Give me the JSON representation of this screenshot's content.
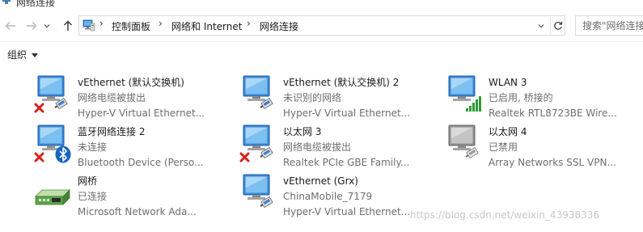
{
  "window": {
    "title": "网络连接"
  },
  "nav": {
    "back_icon": "arrow-left-icon",
    "forward_icon": "arrow-right-icon",
    "recent_icon": "chevron-down-icon",
    "up_icon": "arrow-up-icon"
  },
  "address": {
    "crumbs": [
      "控制面板",
      "网络和 Internet",
      "网络连接"
    ],
    "separator": "›"
  },
  "search": {
    "placeholder": "搜索\"网络连接\""
  },
  "toolbar": {
    "organize_label": "组织"
  },
  "connections": [
    {
      "name": "vEthernet (默认交换机)",
      "status": "网络电缆被拔出",
      "device": "Hyper-V Virtual Ethernet...",
      "icon": "ethernet-adapter-icon",
      "badge": "red-x"
    },
    {
      "name": "vEthernet (默认交换机) 2",
      "status": "未识别的网络",
      "device": "Hyper-V Virtual Ethernet...",
      "icon": "ethernet-adapter-icon",
      "badge": "none"
    },
    {
      "name": "WLAN 3",
      "status": "已启用, 桥接的",
      "device": "Realtek RTL8723BE Wire...",
      "icon": "wireless-adapter-icon",
      "badge": "signal"
    },
    {
      "name": "蓝牙网络连接 2",
      "status": "未连接",
      "device": "Bluetooth Device (Perso...",
      "icon": "bluetooth-adapter-icon",
      "badge": "red-x-bluetooth"
    },
    {
      "name": "以太网 3",
      "status": "网络电缆被拔出",
      "device": "Realtek PCIe GBE Family...",
      "icon": "ethernet-adapter-icon",
      "badge": "red-x"
    },
    {
      "name": "以太网 4",
      "status": "已禁用",
      "device": "Array Networks SSL VPN...",
      "icon": "ethernet-adapter-disabled-icon",
      "badge": "none"
    },
    {
      "name": "网桥",
      "status": "已连接",
      "device": "Microsoft Network Ada...",
      "icon": "network-bridge-icon",
      "badge": "none"
    },
    {
      "name": "vEthernet (Grx)",
      "status": "ChinaMobile_7179",
      "device": "Hyper-V Virtual Ethernet...",
      "icon": "ethernet-adapter-icon",
      "badge": "none"
    }
  ],
  "watermark": "https://blog.csdn.net/weixin_43938336",
  "colors": {
    "monitor_blue": "#2f7fd3",
    "error_red": "#d7221f",
    "signal_green": "#2e9b36",
    "bluetooth_blue": "#1565c0",
    "bridge_green": "#5fa34b"
  }
}
